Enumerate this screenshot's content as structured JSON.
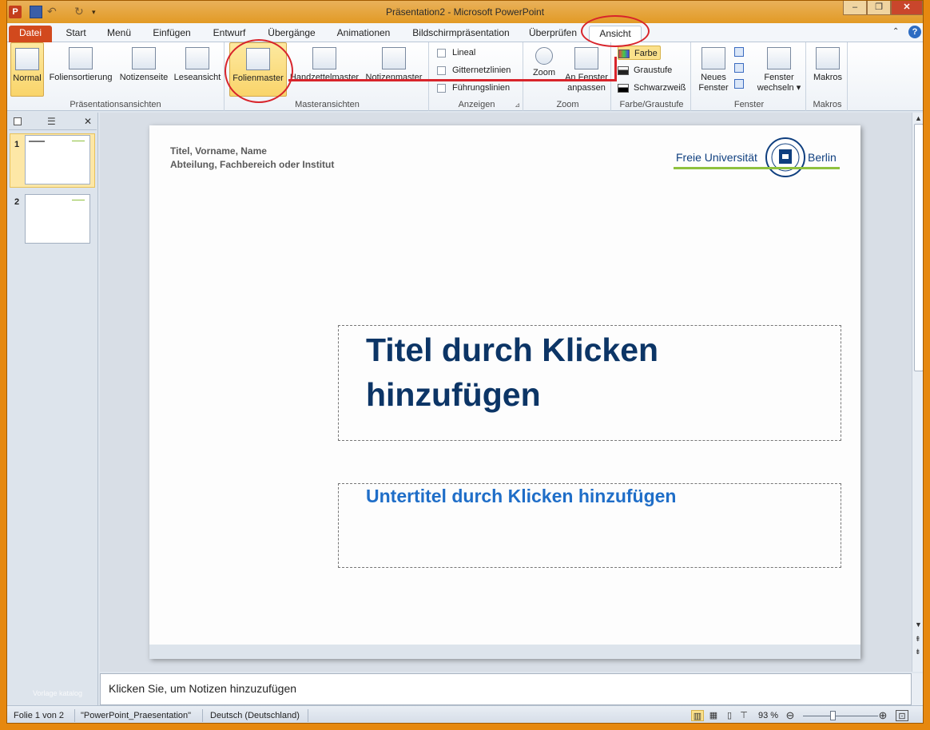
{
  "window": {
    "title": "Präsentation2  -  Microsoft PowerPoint",
    "min": "–",
    "max": "❐",
    "close": "✕"
  },
  "quickaccess": {
    "app": "P",
    "undo": "↶",
    "redo": "↻",
    "more": "▾"
  },
  "tabs": [
    "Datei",
    "Start",
    "Menü",
    "Einfügen",
    "Entwurf",
    "Übergänge",
    "Animationen",
    "Bildschirmpräsentation",
    "Überprüfen",
    "Ansicht"
  ],
  "ribbon": {
    "praesentationsansichten": {
      "label": "Präsentationsansichten",
      "buttons": [
        "Normal",
        "Foliensortierung",
        "Notizenseite",
        "Leseansicht"
      ]
    },
    "masteransichten": {
      "label": "Masteransichten",
      "buttons": [
        "Folienmaster",
        "Handzettelmaster",
        "Notizenmaster"
      ]
    },
    "anzeigen": {
      "label": "Anzeigen",
      "checks": [
        "Lineal",
        "Gitternetzlinien",
        "Führungslinien"
      ],
      "launcher": "⊿"
    },
    "zoom": {
      "label": "Zoom",
      "buttons": [
        "Zoom",
        "An Fenster anpassen"
      ]
    },
    "farbe": {
      "label": "Farbe/Graustufe",
      "options": [
        "Farbe",
        "Graustufe",
        "Schwarzweiß"
      ]
    },
    "fenster": {
      "label": "Fenster",
      "buttons": [
        "Neues Fenster",
        "Fenster wechseln ▾"
      ]
    },
    "makros": {
      "label": "Makros",
      "buttons": [
        "Makros"
      ]
    }
  },
  "leftpane": {
    "close": "✕",
    "slides": [
      "1",
      "2"
    ],
    "watermark": "Vorlage katalog"
  },
  "slide": {
    "author_line1": "Titel, Vorname, Name",
    "author_line2": "Abteilung,  Fachbereich  oder Institut",
    "logo_left": "Freie Universität",
    "logo_right": "Berlin",
    "title": "Titel durch Klicken hinzufügen",
    "subtitle": "Untertitel durch Klicken hinzufügen"
  },
  "notes": {
    "placeholder": "Klicken Sie, um Notizen hinzuzufügen"
  },
  "status": {
    "slide": "Folie 1 von 2",
    "theme": "\"PowerPoint_Praesentation\"",
    "language": "Deutsch (Deutschland)",
    "zoom": "93 %",
    "zoom_percent": 93,
    "zoom_out": "⊖",
    "zoom_in": "⊕"
  },
  "colors": {
    "accent": "#d8242b",
    "title": "#0c3566",
    "subtitle": "#1f6ec8",
    "datei": "#d2491d"
  }
}
